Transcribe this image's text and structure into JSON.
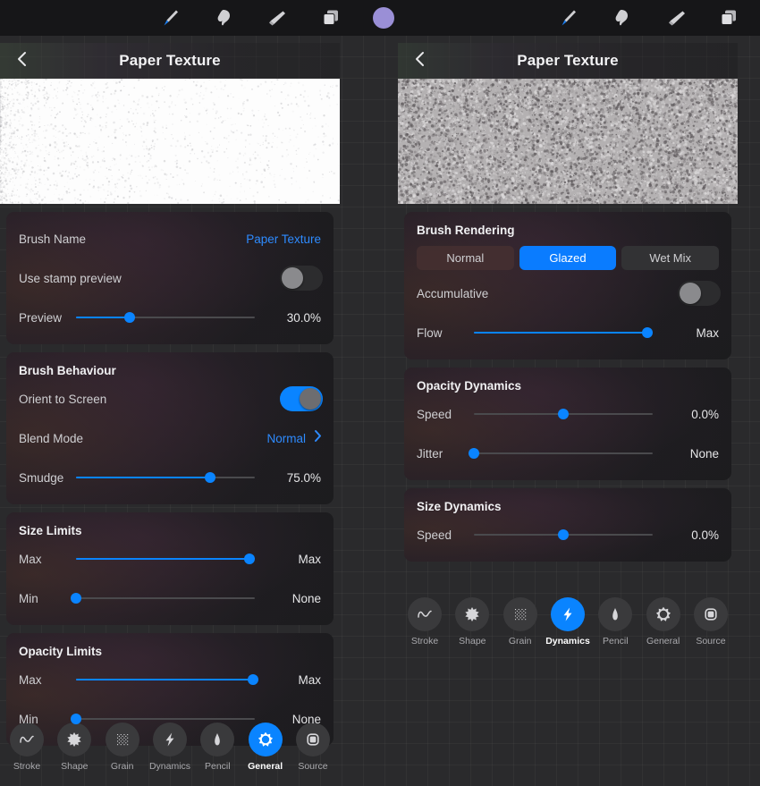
{
  "toolbar": {
    "left_tools": [
      {
        "name": "brush-tool",
        "icon": "paintbrush-icon",
        "active": true
      },
      {
        "name": "smudge-tool",
        "icon": "smudge-finger-icon",
        "active": false
      },
      {
        "name": "eraser-tool",
        "icon": "eraser-icon",
        "active": false
      },
      {
        "name": "layers-tool",
        "icon": "layers-icon",
        "active": false
      }
    ],
    "color_swatch": {
      "name": "color-swatch",
      "color": "#9a8fd6"
    },
    "right_tools": [
      {
        "name": "brush-tool",
        "icon": "paintbrush-icon",
        "active": true
      },
      {
        "name": "smudge-tool",
        "icon": "smudge-finger-icon",
        "active": false
      },
      {
        "name": "eraser-tool",
        "icon": "eraser-icon",
        "active": false
      },
      {
        "name": "layers-tool",
        "icon": "layers-icon",
        "active": false
      }
    ]
  },
  "left_panel": {
    "title": "Paper Texture",
    "back_icon": "chevron-left-icon",
    "preview_label": "brush-stroke-preview",
    "sections": [
      {
        "title": "",
        "rows": [
          {
            "label": "Brush Name",
            "value": "Paper Texture",
            "type": "link"
          },
          {
            "label": "Use stamp preview",
            "type": "toggle",
            "on": false
          },
          {
            "label": "Preview",
            "type": "slider",
            "value": "30.0%",
            "percent": 30
          }
        ]
      },
      {
        "title": "Brush Behaviour",
        "rows": [
          {
            "label": "Orient to Screen",
            "type": "toggle",
            "on": true
          },
          {
            "label": "Blend Mode",
            "value": "Normal",
            "type": "disclosure"
          },
          {
            "label": "Smudge",
            "type": "slider",
            "value": "75.0%",
            "percent": 75
          }
        ]
      },
      {
        "title": "Size Limits",
        "rows": [
          {
            "label": "Max",
            "type": "slider",
            "value": "Max",
            "percent": 97
          },
          {
            "label": "Min",
            "type": "slider",
            "value": "None",
            "percent": 0
          }
        ]
      },
      {
        "title": "Opacity Limits",
        "rows": [
          {
            "label": "Max",
            "type": "slider",
            "value": "Max",
            "percent": 99
          },
          {
            "label": "Min",
            "type": "slider",
            "value": "None",
            "percent": 0
          }
        ]
      }
    ],
    "tabs": [
      {
        "label": "Stroke",
        "icon": "wave-icon",
        "active": false
      },
      {
        "label": "Shape",
        "icon": "starburst-icon",
        "active": false
      },
      {
        "label": "Grain",
        "icon": "grain-dots-icon",
        "active": false
      },
      {
        "label": "Dynamics",
        "icon": "lightning-bolt-icon",
        "active": false
      },
      {
        "label": "Pencil",
        "icon": "apple-pencil-icon",
        "active": false
      },
      {
        "label": "General",
        "icon": "gear-icon",
        "active": true
      },
      {
        "label": "Source",
        "icon": "rounded-square-icon",
        "active": false
      }
    ]
  },
  "right_panel": {
    "title": "Paper Texture",
    "back_icon": "chevron-left-icon",
    "preview_label": "brush-stroke-preview",
    "brush_rendering": {
      "title": "Brush Rendering",
      "options": [
        {
          "label": "Normal",
          "active": false
        },
        {
          "label": "Glazed",
          "active": true
        },
        {
          "label": "Wet Mix",
          "active": false
        }
      ],
      "rows": [
        {
          "label": "Accumulative",
          "type": "toggle",
          "on": false
        },
        {
          "label": "Flow",
          "type": "slider",
          "value": "Max",
          "percent": 97
        }
      ]
    },
    "sections": [
      {
        "title": "Opacity Dynamics",
        "rows": [
          {
            "label": "Speed",
            "type": "slider",
            "value": "0.0%",
            "percent": 50,
            "filled": false
          },
          {
            "label": "Jitter",
            "type": "slider",
            "value": "None",
            "percent": 0,
            "filled": false
          }
        ]
      },
      {
        "title": "Size Dynamics",
        "rows": [
          {
            "label": "Speed",
            "type": "slider",
            "value": "0.0%",
            "percent": 50,
            "filled": false
          }
        ]
      }
    ],
    "tabs": [
      {
        "label": "Stroke",
        "icon": "wave-icon",
        "active": false
      },
      {
        "label": "Shape",
        "icon": "starburst-icon",
        "active": false
      },
      {
        "label": "Grain",
        "icon": "grain-dots-icon",
        "active": false
      },
      {
        "label": "Dynamics",
        "icon": "lightning-bolt-icon",
        "active": true
      },
      {
        "label": "Pencil",
        "icon": "apple-pencil-icon",
        "active": false
      },
      {
        "label": "General",
        "icon": "gear-icon",
        "active": false
      },
      {
        "label": "Source",
        "icon": "rounded-square-icon",
        "active": false
      }
    ]
  },
  "colors": {
    "accent": "#0a84ff",
    "accent_text": "#2e8bff",
    "card_bg": "#1c1c1e",
    "canvas_bg": "#2a2a2c",
    "toolbar_bg": "#161618"
  }
}
